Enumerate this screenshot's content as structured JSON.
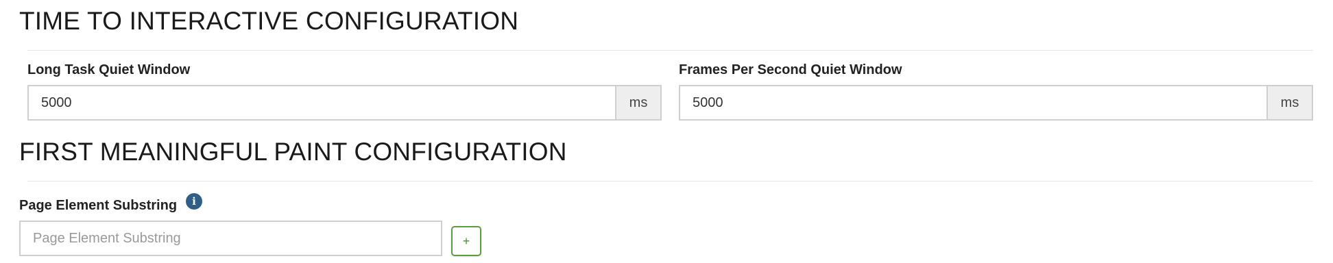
{
  "tti_section": {
    "heading": "TIME TO INTERACTIVE CONFIGURATION",
    "long_task": {
      "label": "Long Task Quiet Window",
      "value": "5000",
      "unit": "ms"
    },
    "fps": {
      "label": "Frames Per Second Quiet Window",
      "value": "5000",
      "unit": "ms"
    }
  },
  "fmp_section": {
    "heading": "FIRST MEANINGFUL PAINT CONFIGURATION",
    "page_element": {
      "label": "Page Element Substring",
      "placeholder": "Page Element Substring",
      "value": "",
      "info_icon": "info-icon",
      "add_label": "+"
    }
  },
  "colors": {
    "info_icon": "#2f5f86",
    "add_button_border": "#5a9e3c",
    "addon_background": "#eeeeee"
  }
}
